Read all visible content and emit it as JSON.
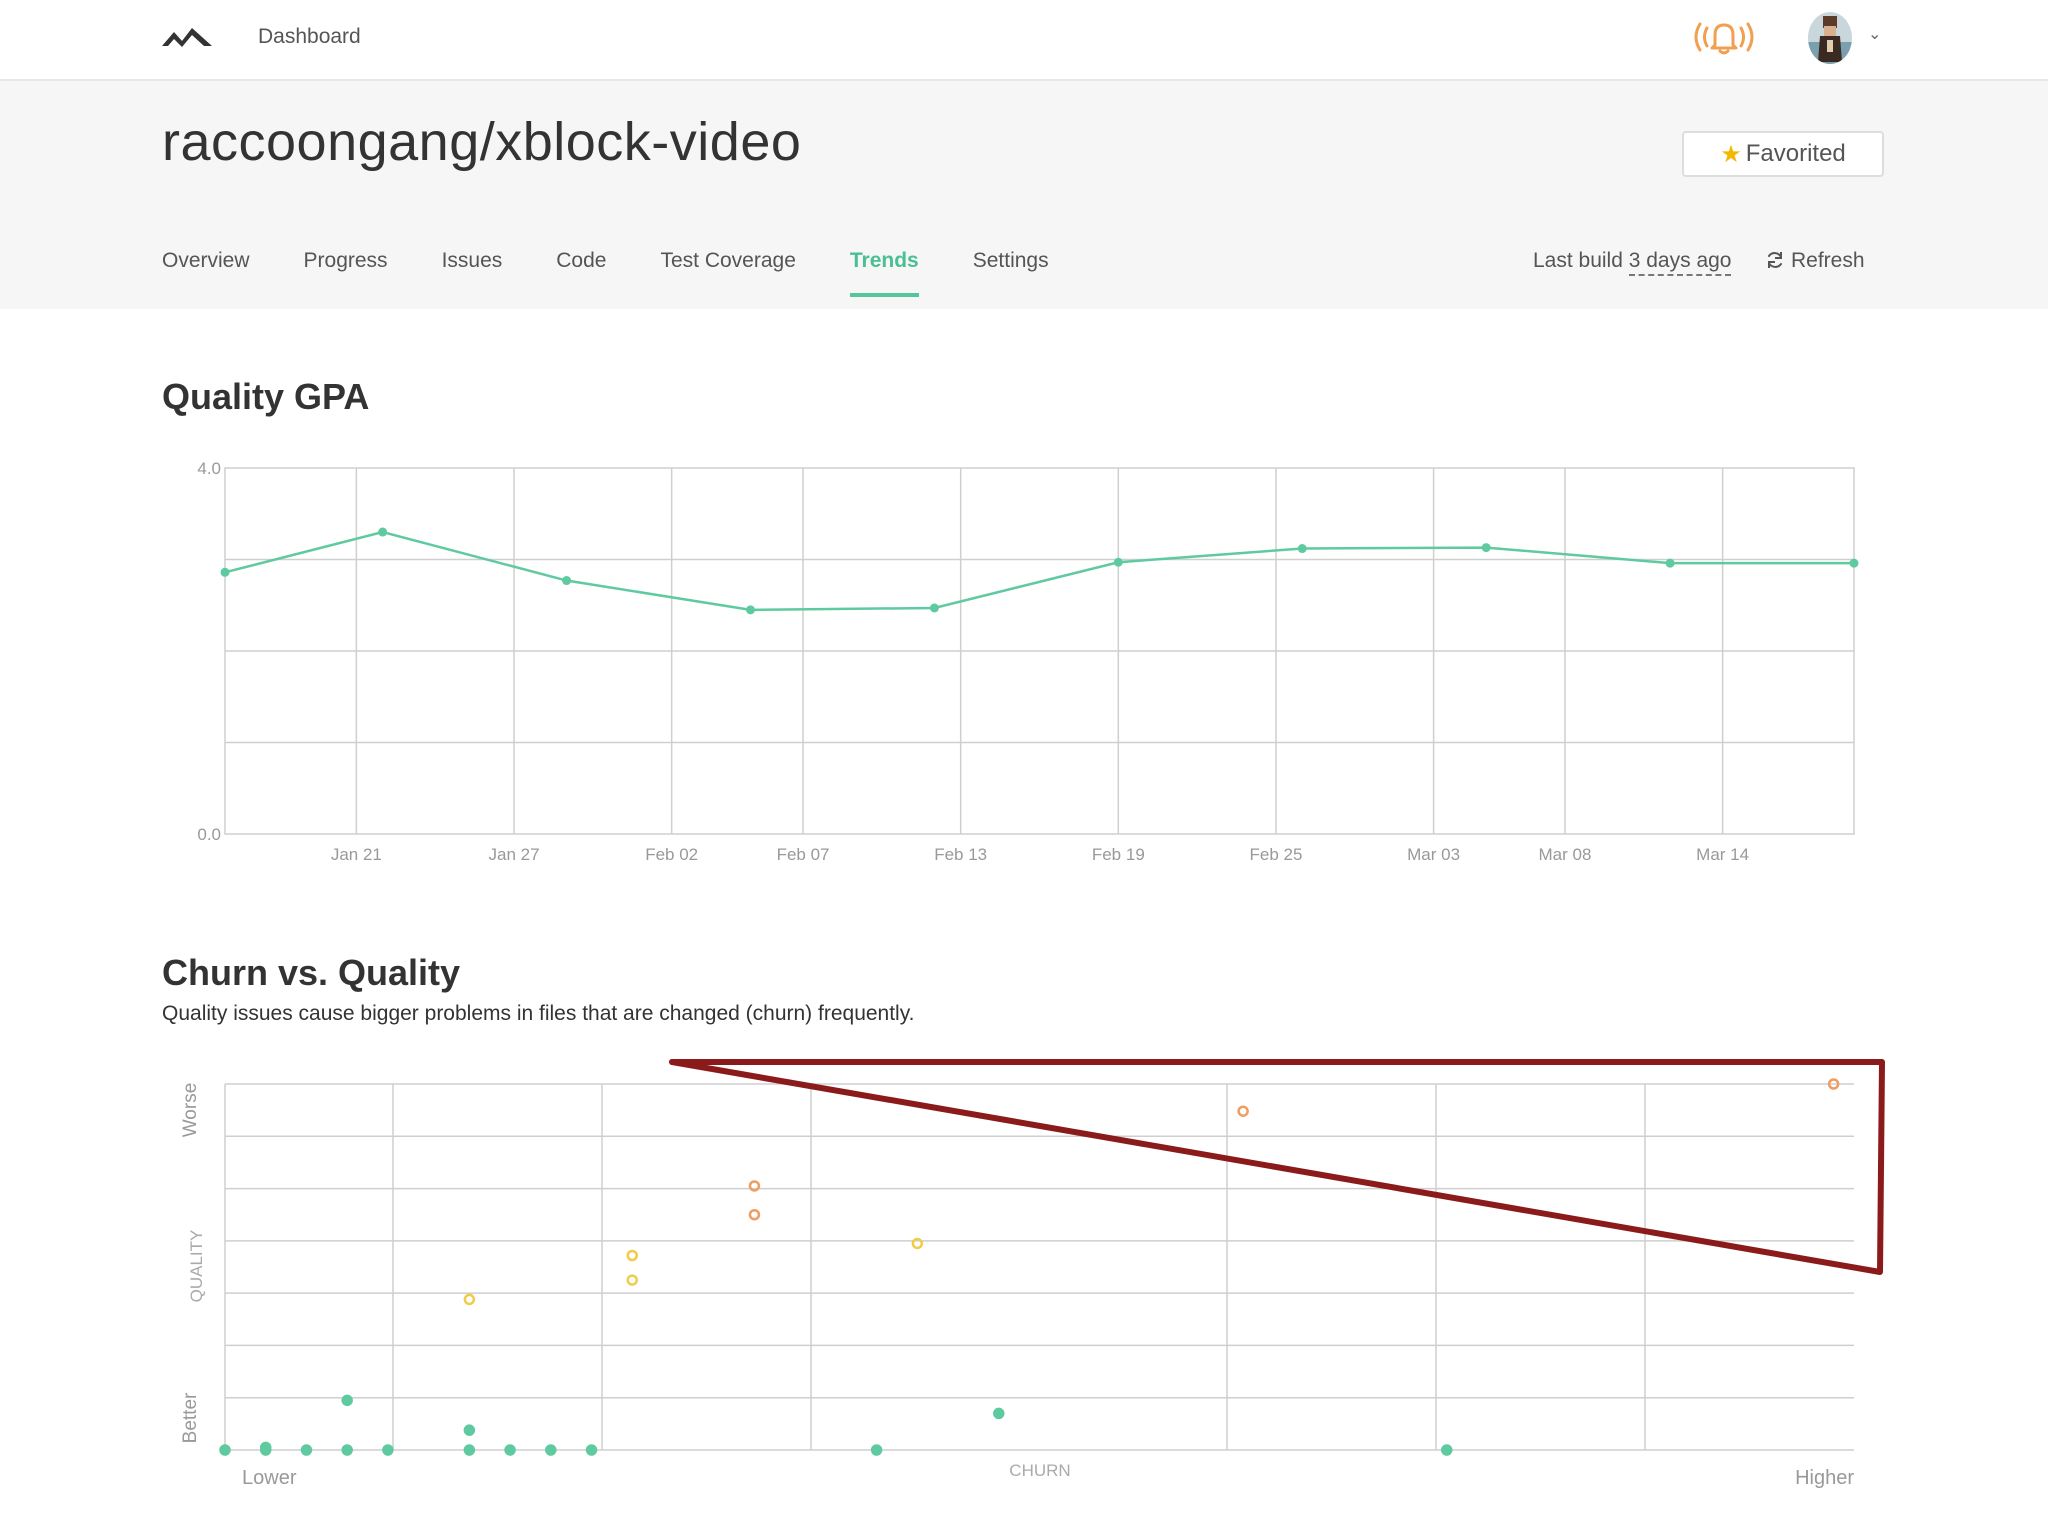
{
  "topbar": {
    "nav_dashboard": "Dashboard",
    "notifications_icon": "bell-icon",
    "avatar_icon": "user-avatar",
    "menu_caret_icon": "chevron-down-icon"
  },
  "repo": {
    "title": "raccoongang/xblock-video",
    "favorite_label": "Favorited",
    "favorite_icon": "star-icon"
  },
  "tabs": [
    {
      "label": "Overview",
      "active": false
    },
    {
      "label": "Progress",
      "active": false
    },
    {
      "label": "Issues",
      "active": false
    },
    {
      "label": "Code",
      "active": false
    },
    {
      "label": "Test Coverage",
      "active": false
    },
    {
      "label": "Trends",
      "active": true
    },
    {
      "label": "Settings",
      "active": false
    }
  ],
  "build": {
    "prefix": "Last build ",
    "ago": "3 days ago",
    "refresh_label": "Refresh",
    "refresh_icon": "refresh-icon"
  },
  "colors": {
    "accent": "#55c69c",
    "line": "#5fcaa0",
    "grid": "#cfcfcf",
    "point_green": "#5fcaa0",
    "point_yellow": "#f0cc4a",
    "point_orange": "#ef9d60",
    "annotation": "#8b1a1a"
  },
  "gpa_section": {
    "title": "Quality GPA"
  },
  "churn_section": {
    "title": "Churn vs. Quality",
    "subtitle": "Quality issues cause bigger problems in files that are changed (churn) frequently."
  },
  "chart_data": [
    {
      "type": "line",
      "title": "Quality GPA",
      "ylim": [
        0,
        4
      ],
      "ytick_labels": [
        "0.0",
        "4.0"
      ],
      "xtick_labels": [
        "Jan 21",
        "Jan 27",
        "Feb 02",
        "Feb 07",
        "Feb 13",
        "Feb 19",
        "Feb 25",
        "Mar 03",
        "Mar 08",
        "Mar 14"
      ],
      "xlim": [
        "2017-01-16",
        "2017-03-19"
      ],
      "x_ticks": [
        "2017-01-21",
        "2017-01-27",
        "2017-02-02",
        "2017-02-07",
        "2017-02-13",
        "2017-02-19",
        "2017-02-25",
        "2017-03-03",
        "2017-03-08",
        "2017-03-14"
      ],
      "grid": true,
      "series": [
        {
          "x": [
            "2017-01-16",
            "2017-01-22",
            "2017-01-29",
            "2017-02-05",
            "2017-02-12",
            "2017-02-19",
            "2017-02-26",
            "2017-03-05",
            "2017-03-12",
            "2017-03-19"
          ],
          "y": [
            2.86,
            3.3,
            2.77,
            2.45,
            2.47,
            2.97,
            3.12,
            3.13,
            2.96,
            2.96
          ]
        }
      ]
    },
    {
      "type": "scatter",
      "title": "Churn vs. Quality",
      "xlabel": "CHURN",
      "ylabel": "QUALITY",
      "x_end_labels": [
        "Lower",
        "Higher"
      ],
      "y_end_labels": [
        "Better",
        "Worse"
      ],
      "xlim": [
        0,
        40
      ],
      "ylim": [
        0,
        7
      ],
      "grid": true,
      "points": [
        {
          "x": 0,
          "y": 0,
          "c": "green"
        },
        {
          "x": 1,
          "y": 0,
          "c": "green"
        },
        {
          "x": 1,
          "y": 0.05,
          "c": "green"
        },
        {
          "x": 2,
          "y": 0,
          "c": "green"
        },
        {
          "x": 3,
          "y": 0,
          "c": "green"
        },
        {
          "x": 3,
          "y": 0.95,
          "c": "green"
        },
        {
          "x": 4,
          "y": 0,
          "c": "green"
        },
        {
          "x": 6,
          "y": 0,
          "c": "green"
        },
        {
          "x": 6,
          "y": 0.38,
          "c": "green"
        },
        {
          "x": 7,
          "y": 0,
          "c": "green"
        },
        {
          "x": 8,
          "y": 0,
          "c": "green"
        },
        {
          "x": 9,
          "y": 0,
          "c": "green"
        },
        {
          "x": 6,
          "y": 2.88,
          "c": "yellow"
        },
        {
          "x": 10,
          "y": 3.25,
          "c": "yellow"
        },
        {
          "x": 10,
          "y": 3.72,
          "c": "yellow"
        },
        {
          "x": 13,
          "y": 4.5,
          "c": "orange"
        },
        {
          "x": 13,
          "y": 5.05,
          "c": "orange"
        },
        {
          "x": 16,
          "y": 0,
          "c": "green"
        },
        {
          "x": 17,
          "y": 3.95,
          "c": "yellow"
        },
        {
          "x": 19,
          "y": 0.7,
          "c": "green"
        },
        {
          "x": 25,
          "y": 6.48,
          "c": "orange"
        },
        {
          "x": 30,
          "y": 0,
          "c": "green"
        },
        {
          "x": 39.5,
          "y": 7,
          "c": "orange"
        }
      ]
    }
  ]
}
